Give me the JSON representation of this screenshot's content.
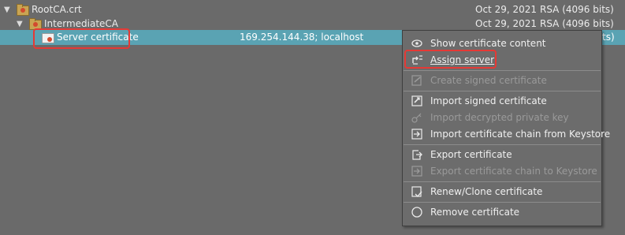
{
  "tree": {
    "rows": [
      {
        "name": "RootCA.crt",
        "date": "Oct 29, 2021",
        "algo": "RSA (4096 bits)"
      },
      {
        "name": "IntermediateCA",
        "date": "Oct 29, 2021",
        "algo": "RSA (4096 bits)"
      },
      {
        "name": "Server certificate",
        "hosts": "169.254.144.38; localhost",
        "algo_partial": "ts)"
      }
    ]
  },
  "context_menu": {
    "items": [
      {
        "label": "Show certificate content",
        "icon": "eye-icon",
        "enabled": true
      },
      {
        "label": "Assign server",
        "icon": "assign-server-icon",
        "enabled": true
      },
      {
        "label": "Create signed certificate",
        "icon": "sign-cert-icon",
        "enabled": false
      },
      {
        "label": "Import signed certificate",
        "icon": "import-cert-icon",
        "enabled": true
      },
      {
        "label": "Import decrypted private key",
        "icon": "key-icon",
        "enabled": false
      },
      {
        "label": "Import certificate chain from Keystore",
        "icon": "import-chain-icon",
        "enabled": true
      },
      {
        "label": "Export certificate",
        "icon": "export-cert-icon",
        "enabled": true
      },
      {
        "label": "Export certificate chain to Keystore",
        "icon": "export-chain-icon",
        "enabled": false
      },
      {
        "label": "Renew/Clone certificate",
        "icon": "renew-icon",
        "enabled": true
      },
      {
        "label": "Remove certificate",
        "icon": "remove-icon",
        "enabled": true
      }
    ]
  },
  "colors": {
    "selection": "#5aa3b3",
    "highlight": "#e53935",
    "background": "#6a6a6a"
  }
}
